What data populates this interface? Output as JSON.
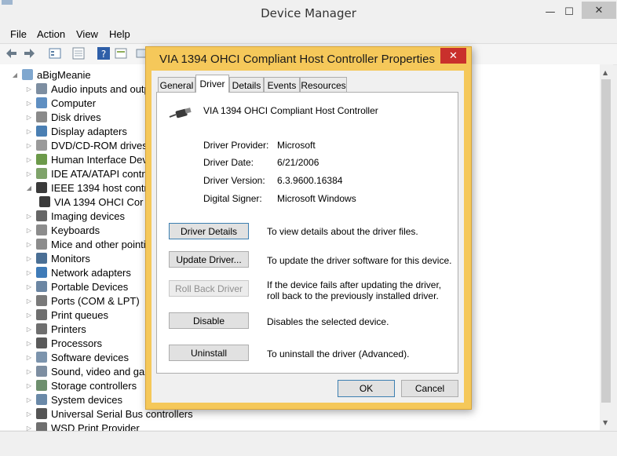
{
  "window": {
    "title": "Device Manager",
    "controls": {
      "minimize": "—",
      "maximize": "☐",
      "close": "✕"
    }
  },
  "menu": {
    "file": "File",
    "action": "Action",
    "view": "View",
    "help": "Help"
  },
  "tree": {
    "root": "aBigMeanie",
    "items": [
      {
        "label": "Audio inputs and outp",
        "icon": "speaker-icon",
        "expanded": false
      },
      {
        "label": "Computer",
        "icon": "computer-icon",
        "expanded": false
      },
      {
        "label": "Disk drives",
        "icon": "disk-icon",
        "expanded": false
      },
      {
        "label": "Display adapters",
        "icon": "display-icon",
        "expanded": false
      },
      {
        "label": "DVD/CD-ROM drives",
        "icon": "dvd-icon",
        "expanded": false
      },
      {
        "label": "Human Interface Devic",
        "icon": "hid-icon",
        "expanded": false
      },
      {
        "label": "IDE ATA/ATAPI contro",
        "icon": "ide-icon",
        "expanded": false
      },
      {
        "label": "IEEE 1394 host controll",
        "icon": "ieee1394-icon",
        "expanded": true
      },
      {
        "label": "VIA 1394 OHCI Cor",
        "icon": "ieee1394-device-icon",
        "child": true
      },
      {
        "label": "Imaging devices",
        "icon": "camera-icon",
        "expanded": false
      },
      {
        "label": "Keyboards",
        "icon": "keyboard-icon",
        "expanded": false
      },
      {
        "label": "Mice and other pointin",
        "icon": "mouse-icon",
        "expanded": false
      },
      {
        "label": "Monitors",
        "icon": "monitor-icon",
        "expanded": false
      },
      {
        "label": "Network adapters",
        "icon": "network-icon",
        "expanded": false
      },
      {
        "label": "Portable Devices",
        "icon": "portable-icon",
        "expanded": false
      },
      {
        "label": "Ports (COM & LPT)",
        "icon": "port-icon",
        "expanded": false
      },
      {
        "label": "Print queues",
        "icon": "printer-icon",
        "expanded": false
      },
      {
        "label": "Printers",
        "icon": "printer-icon",
        "expanded": false
      },
      {
        "label": "Processors",
        "icon": "cpu-icon",
        "expanded": false
      },
      {
        "label": "Software devices",
        "icon": "software-icon",
        "expanded": false
      },
      {
        "label": "Sound, video and gam",
        "icon": "sound-icon",
        "expanded": false
      },
      {
        "label": "Storage controllers",
        "icon": "storage-icon",
        "expanded": false
      },
      {
        "label": "System devices",
        "icon": "system-icon",
        "expanded": false
      },
      {
        "label": "Universal Serial Bus controllers",
        "icon": "usb-icon",
        "expanded": false
      },
      {
        "label": "WSD Print Provider",
        "icon": "printer-icon",
        "expanded": false
      }
    ]
  },
  "dialog": {
    "title": "VIA 1394 OHCI Compliant Host Controller Properties",
    "tabs": [
      "General",
      "Driver",
      "Details",
      "Events",
      "Resources"
    ],
    "active_tab": "Driver",
    "device_name": "VIA 1394 OHCI Compliant Host Controller",
    "fields": [
      {
        "label": "Driver Provider:",
        "value": "Microsoft"
      },
      {
        "label": "Driver Date:",
        "value": "6/21/2006"
      },
      {
        "label": "Driver Version:",
        "value": "6.3.9600.16384"
      },
      {
        "label": "Digital Signer:",
        "value": "Microsoft Windows"
      }
    ],
    "actions": [
      {
        "button": "Driver Details",
        "desc": "To view details about the driver files."
      },
      {
        "button": "Update Driver...",
        "desc": "To update the driver software for this device."
      },
      {
        "button": "Roll Back Driver",
        "desc": "If the device fails after updating the driver, roll back to the previously installed driver.",
        "disabled": true
      },
      {
        "button": "Disable",
        "desc": "Disables the selected device."
      },
      {
        "button": "Uninstall",
        "desc": "To uninstall the driver (Advanced)."
      }
    ],
    "ok": "OK",
    "cancel": "Cancel",
    "close": "✕"
  },
  "colors": {
    "dialog_frame": "#f5c85a",
    "close_red": "#c9302c",
    "focus_border": "#3c7fb1"
  }
}
